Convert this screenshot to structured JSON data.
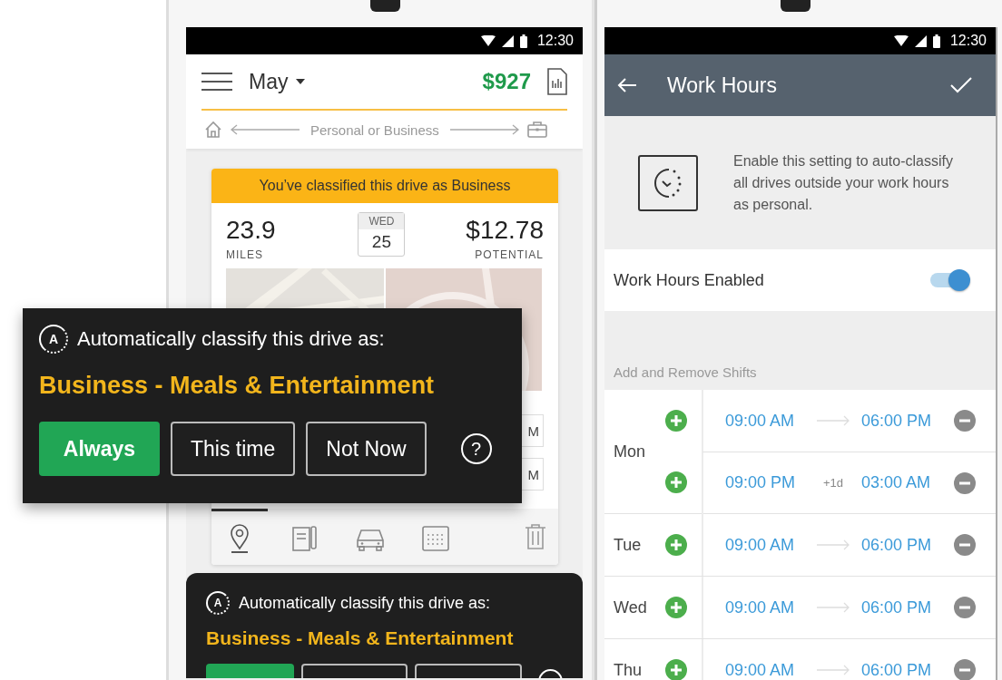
{
  "left_phone": {
    "status_bar": {
      "time": "12:30"
    },
    "header": {
      "month": "May",
      "total": "$927"
    },
    "classify_bar": {
      "label": "Personal or Business"
    },
    "drive_card": {
      "banner": "You’ve classified this drive as Business",
      "miles": {
        "value": "23.9",
        "label": "MILES"
      },
      "date": {
        "weekday": "WED",
        "day": "25"
      },
      "potential": {
        "value": "$12.78",
        "label": "POTENTIAL"
      },
      "time_fields": [
        "M",
        "M"
      ],
      "tabs": [
        {
          "kind": "pin",
          "selected": true
        },
        {
          "kind": "note",
          "selected": false
        },
        {
          "kind": "car",
          "selected": false
        },
        {
          "kind": "calendar",
          "selected": false
        }
      ]
    },
    "bottom_sheet": {
      "badge": "A",
      "prompt": "Automatically classify this drive as:",
      "category": "Business - Meals & Entertainment",
      "buttons": [
        {
          "kind": "primary"
        },
        {
          "kind": "outline"
        },
        {
          "kind": "outline"
        },
        {
          "kind": "help"
        }
      ]
    }
  },
  "callout": {
    "badge": "A",
    "prompt": "Automatically classify this drive as:",
    "category": "Business - Meals & Entertainment",
    "buttons": [
      {
        "label": "Always",
        "kind": "primary"
      },
      {
        "label": "This time",
        "kind": "outline"
      },
      {
        "label": "Not Now",
        "kind": "outline"
      },
      {
        "label": "?",
        "kind": "help"
      }
    ]
  },
  "right_phone": {
    "status_bar": {
      "time": "12:30"
    },
    "app_bar": {
      "title": "Work Hours"
    },
    "info": {
      "text": "Enable this setting to auto-classify all drives outside your work hours as personal."
    },
    "toggle": {
      "label": "Work Hours Enabled",
      "on": true
    },
    "section_label": "Add and Remove Shifts",
    "days": [
      {
        "day": "Mon",
        "shifts": [
          {
            "start": "09:00 AM",
            "end": "06:00 PM"
          },
          {
            "start": "09:00 PM",
            "next_day": "+1d",
            "end": "03:00 AM"
          }
        ]
      },
      {
        "day": "Tue",
        "shifts": [
          {
            "start": "09:00 AM",
            "end": "06:00 PM"
          }
        ]
      },
      {
        "day": "Wed",
        "shifts": [
          {
            "start": "09:00 AM",
            "end": "06:00 PM"
          }
        ]
      },
      {
        "day": "Thu",
        "shifts": [
          {
            "start": "09:00 AM",
            "end": "06:00 PM"
          }
        ]
      }
    ]
  }
}
